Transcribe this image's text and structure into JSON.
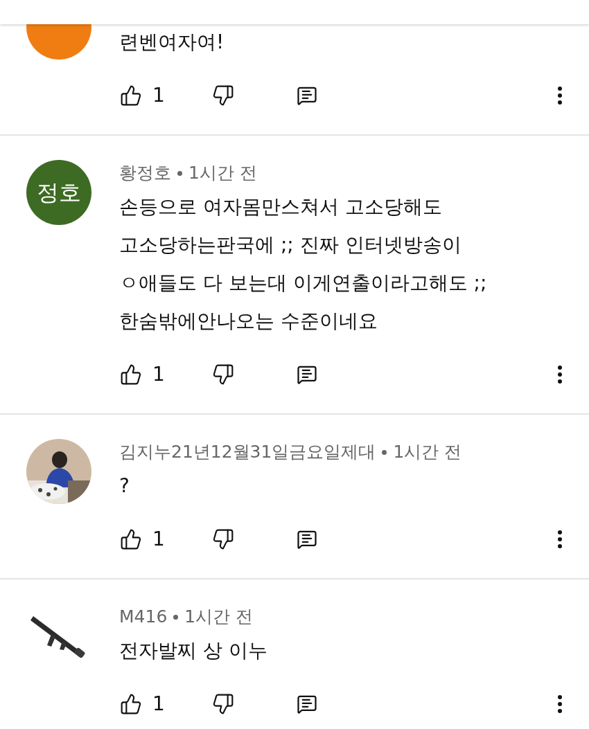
{
  "comments": [
    {
      "avatar": {
        "kind": "plain",
        "color": "#ef7d12"
      },
      "body": "련벤여자여!",
      "likes": "1"
    },
    {
      "avatar": {
        "kind": "initials",
        "color": "#3d6b23",
        "text": "정호"
      },
      "author": "황정호",
      "time": "1시간 전",
      "body": "손등으로 여자몸만스쳐서 고소당해도\n고소당하는판국에 ;; 진짜 인터넷방송이\nㅇ애들도 다 보는대 이게연출이라고해도 ;;\n한숨밖에안나오는 수준이네요",
      "likes": "1"
    },
    {
      "author": "김지누21년12월31일금요일제대",
      "time": "1시간 전",
      "body": "?",
      "likes": "1"
    },
    {
      "avatar": {
        "kind": "item"
      },
      "author": "M416",
      "time": "1시간 전",
      "body": "전자발찌 상 이누",
      "likes": "1"
    }
  ]
}
